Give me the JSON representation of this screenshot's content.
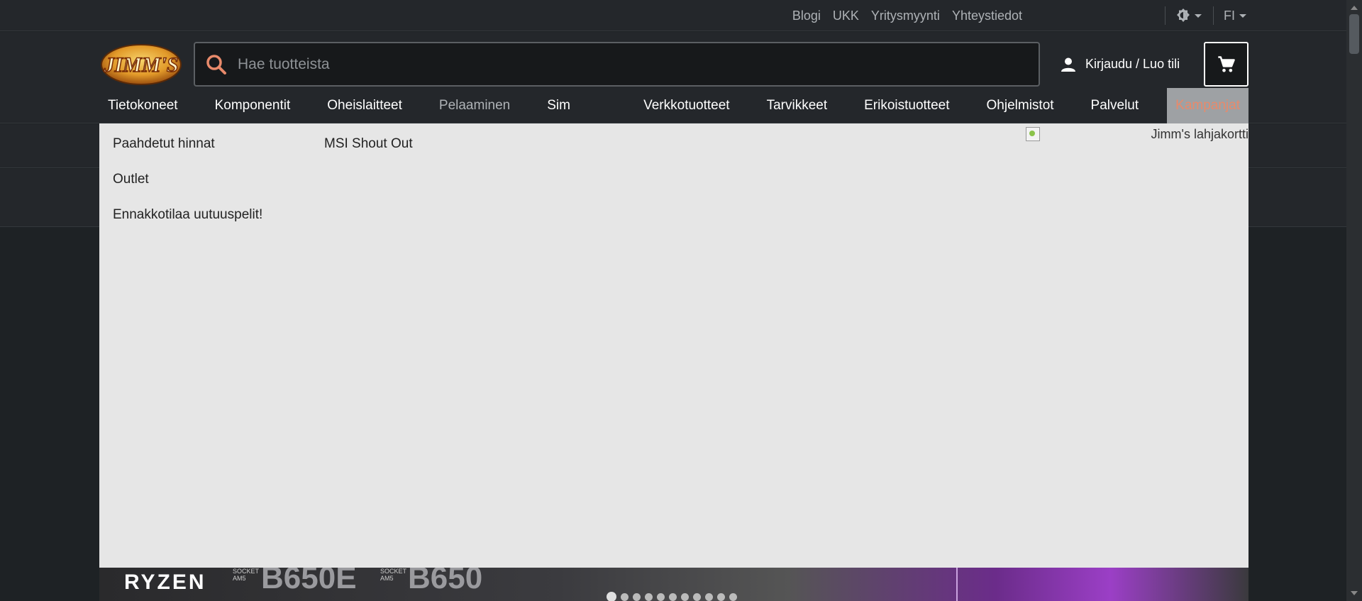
{
  "top_links": [
    "Blogi",
    "UKK",
    "Yritysmyynti",
    "Yhteystiedot"
  ],
  "language": "FI",
  "search": {
    "placeholder": "Hae tuotteista"
  },
  "account": {
    "login_label": "Kirjaudu / Luo tili"
  },
  "logo": {
    "text": "JIMM'S"
  },
  "nav": [
    {
      "label": "Tietokoneet"
    },
    {
      "label": "Komponentit"
    },
    {
      "label": "Oheislaitteet"
    },
    {
      "label": "Pelaaminen"
    },
    {
      "label": "Sim Racing"
    },
    {
      "label": "Verkkotuotteet"
    },
    {
      "label": "Tarvikkeet"
    },
    {
      "label": "Erikoistuotteet"
    },
    {
      "label": "Ohjelmistot"
    },
    {
      "label": "Palvelut"
    },
    {
      "label": "Kampanjat"
    }
  ],
  "dropdown": {
    "col1": [
      "Paahdetut hinnat",
      "Outlet",
      "Ennakkotilaa uutuuspelit!"
    ],
    "col2": [
      "MSI Shout Out"
    ],
    "gift_card_alt": "Jimm's lahjakortti"
  },
  "banner": {
    "brand": "RYZEN",
    "socket_label_1": "SOCKET",
    "socket_label_2": "AM5",
    "chips": [
      "B650E",
      "B650"
    ],
    "slide_count": 11
  },
  "colors": {
    "accent": "#e88a6b",
    "dropdown_bg": "#e6e6e6",
    "header_bg": "#24272b"
  }
}
